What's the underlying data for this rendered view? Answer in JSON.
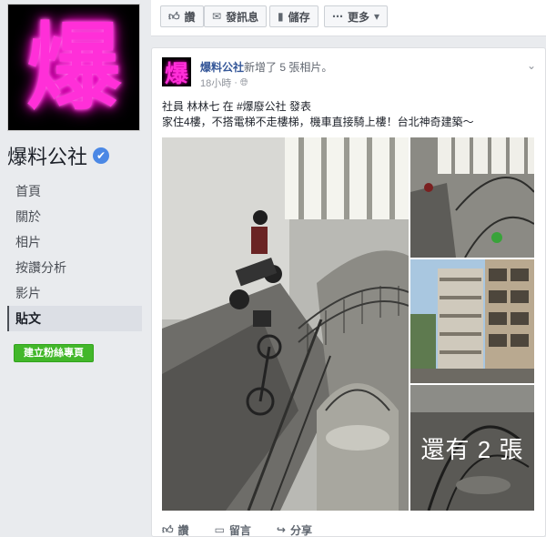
{
  "page": {
    "logo_char": "爆",
    "name": "爆料公社",
    "verified_icon": "✔"
  },
  "nav": [
    {
      "label": "首頁"
    },
    {
      "label": "關於"
    },
    {
      "label": "相片"
    },
    {
      "label": "按讚分析"
    },
    {
      "label": "影片"
    },
    {
      "label": "貼文",
      "active": true
    }
  ],
  "create_button": "建立粉絲專頁",
  "topbar": {
    "like": "讚",
    "message": "發訊息",
    "save": "儲存",
    "more": "更多"
  },
  "post": {
    "avatar_char": "爆",
    "author": "爆料公社",
    "action": "新增了 5 張相片。",
    "time": "18小時",
    "line1": "社員 林林七 在 #爆廢公社 發表",
    "line2": "家住4樓，不搭電梯不走樓梯，機車直接騎上樓！台北神奇建築～",
    "more_photos": "還有 2 張",
    "actions": {
      "like": "讚",
      "comment": "留言",
      "share": "分享"
    }
  },
  "colors": {
    "brand_pink": "#ff2fd8",
    "link": "#365899",
    "green": "#42b72a"
  }
}
